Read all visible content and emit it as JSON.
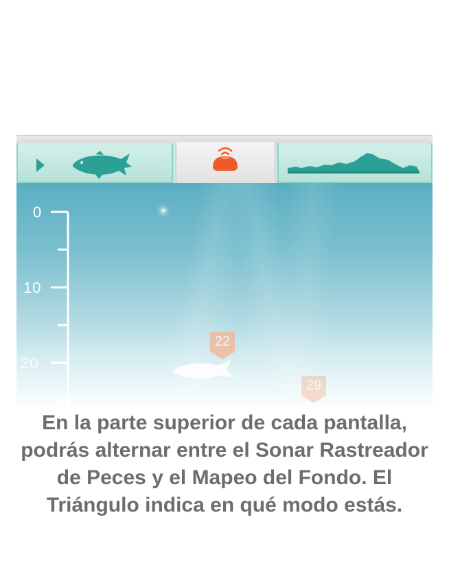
{
  "tabs": [
    {
      "id": "fish",
      "icon": "fish-icon",
      "indicator": "triangle-icon"
    },
    {
      "id": "sonar",
      "icon": "sonar-device-icon",
      "selected": true
    },
    {
      "id": "bottom",
      "icon": "bottom-profile-icon"
    }
  ],
  "depth_scale": [
    "0",
    "10",
    "20"
  ],
  "fish_markers": [
    {
      "depth": "22"
    },
    {
      "depth": "29"
    }
  ],
  "caption": "En la parte superior de cada pantalla, podrás alternar entre el Sonar Rastreador de Peces y el Mapeo del Fondo. El Triángulo indica en qué modo estás.",
  "colors": {
    "accent": "#f05a28",
    "teal": "#2ba195",
    "caption_text": "#6d6d6d"
  }
}
